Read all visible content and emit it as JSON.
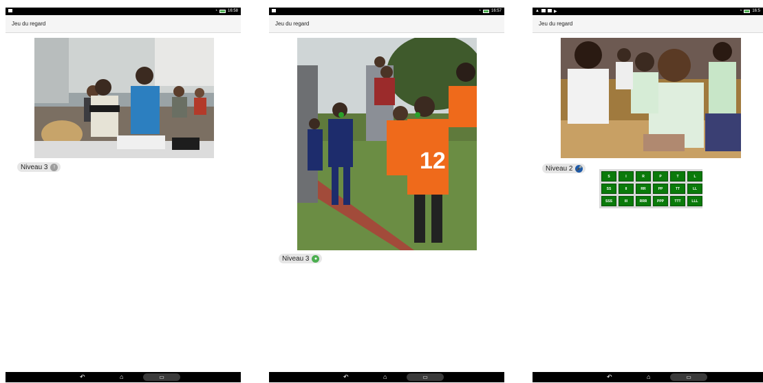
{
  "screens": [
    {
      "status": {
        "time": "16:58"
      },
      "appbar": {
        "title": "Jeu du regard"
      },
      "level": {
        "label": "Niveau 3",
        "icon": "info-icon",
        "icon_color": "#9e9e9e"
      },
      "photo": {
        "icon": "classroom-photo"
      }
    },
    {
      "status": {
        "time": "16:57"
      },
      "appbar": {
        "title": "Jeu du regard"
      },
      "level": {
        "label": "Niveau 3",
        "icon": "eye-icon",
        "icon_color": "#4caf50"
      },
      "photo": {
        "icon": "soccer-kids-photo"
      }
    },
    {
      "status": {
        "time": "16:5"
      },
      "appbar": {
        "title": "Jeu du regard"
      },
      "level": {
        "label": "Niveau 2",
        "icon": "mic-icon",
        "icon_color": "#1e5aa8"
      },
      "photo": {
        "icon": "sitting-children-photo"
      },
      "syllables": [
        [
          "S",
          "I",
          "R",
          "P",
          "T",
          "L"
        ],
        [
          "SS",
          "II",
          "RR",
          "PP",
          "TT",
          "LL"
        ],
        [
          "SSS",
          "III",
          "RRR",
          "PPP",
          "TTT",
          "LLL"
        ]
      ]
    }
  ],
  "colors": {
    "green_button": "#0a7a0a",
    "app_bar": "#f5f5f5"
  }
}
